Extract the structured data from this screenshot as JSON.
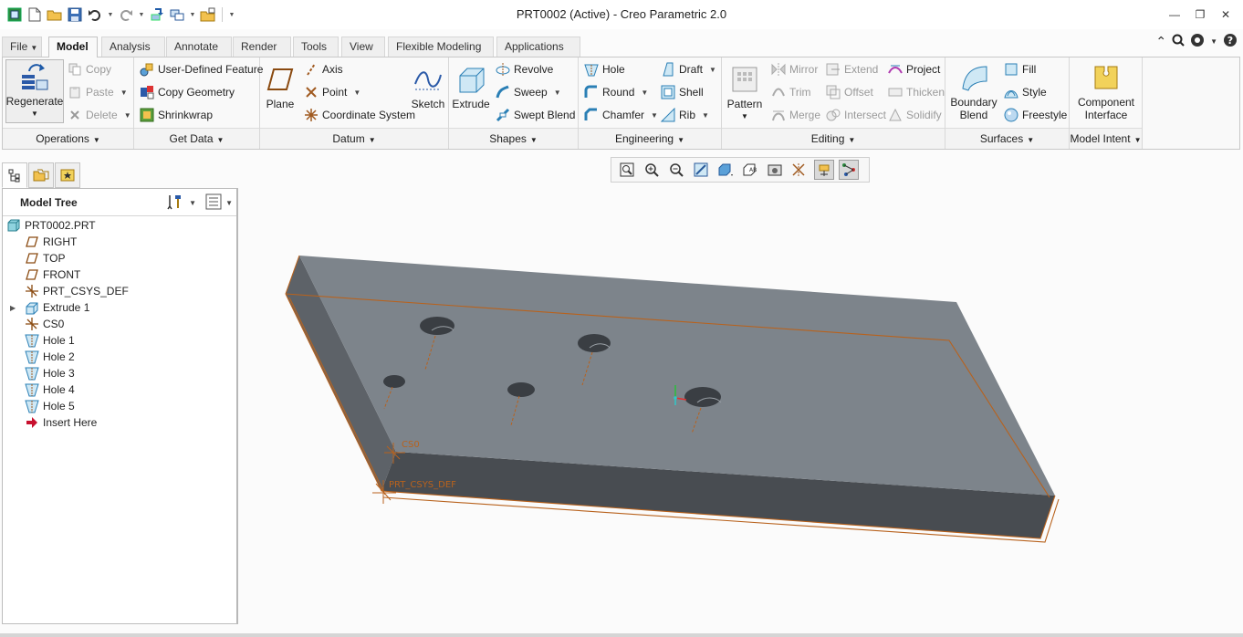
{
  "window": {
    "title": "PRT0002 (Active) - Creo Parametric 2.0",
    "minimize_glyph": "—",
    "restore_glyph": "❐",
    "close_glyph": "✕"
  },
  "tabs": [
    {
      "label": "File"
    },
    {
      "label": "Model"
    },
    {
      "label": "Analysis"
    },
    {
      "label": "Annotate"
    },
    {
      "label": "Render"
    },
    {
      "label": "Tools"
    },
    {
      "label": "View"
    },
    {
      "label": "Flexible Modeling"
    },
    {
      "label": "Applications"
    }
  ],
  "ribbon": {
    "operations": {
      "label": "Operations",
      "regenerate": "Regenerate",
      "copy": "Copy",
      "paste": "Paste",
      "delete": "Delete"
    },
    "get_data": {
      "label": "Get Data",
      "udf": "User-Defined Feature",
      "copy_geometry": "Copy Geometry",
      "shrinkwrap": "Shrinkwrap"
    },
    "datum": {
      "label": "Datum",
      "plane": "Plane",
      "axis": "Axis",
      "point": "Point",
      "csys": "Coordinate System",
      "sketch": "Sketch"
    },
    "shapes": {
      "label": "Shapes",
      "extrude": "Extrude",
      "revolve": "Revolve",
      "sweep": "Sweep",
      "swept_blend": "Swept Blend"
    },
    "engineering": {
      "label": "Engineering",
      "hole": "Hole",
      "round": "Round",
      "chamfer": "Chamfer",
      "draft": "Draft",
      "shell": "Shell",
      "rib": "Rib"
    },
    "editing": {
      "label": "Editing",
      "pattern": "Pattern",
      "mirror": "Mirror",
      "trim": "Trim",
      "merge": "Merge",
      "extend": "Extend",
      "offset": "Offset",
      "intersect": "Intersect",
      "project": "Project",
      "thicken": "Thicken",
      "solidify": "Solidify"
    },
    "surfaces": {
      "label": "Surfaces",
      "boundary_blend_1": "Boundary",
      "boundary_blend_2": "Blend",
      "fill": "Fill",
      "style": "Style",
      "freestyle": "Freestyle"
    },
    "model_intent": {
      "label": "Model Intent",
      "component_1": "Component",
      "component_2": "Interface"
    }
  },
  "model_tree": {
    "title": "Model Tree",
    "items": [
      {
        "label": "PRT0002.PRT",
        "icon": "part-icon"
      },
      {
        "label": "RIGHT",
        "icon": "datum-plane-icon"
      },
      {
        "label": "TOP",
        "icon": "datum-plane-icon"
      },
      {
        "label": "FRONT",
        "icon": "datum-plane-icon"
      },
      {
        "label": "PRT_CSYS_DEF",
        "icon": "csys-icon"
      },
      {
        "label": "Extrude 1",
        "icon": "extrude-icon"
      },
      {
        "label": "CS0",
        "icon": "csys-icon"
      },
      {
        "label": "Hole 1",
        "icon": "hole-icon"
      },
      {
        "label": "Hole 2",
        "icon": "hole-icon"
      },
      {
        "label": "Hole 3",
        "icon": "hole-icon"
      },
      {
        "label": "Hole 4",
        "icon": "hole-icon"
      },
      {
        "label": "Hole 5",
        "icon": "hole-icon"
      },
      {
        "label": "Insert Here",
        "icon": "insert-arrow-icon"
      }
    ]
  },
  "viewport": {
    "csys_label_1": "CS0",
    "csys_label_2": "PRT_CSYS_DEF",
    "colors": {
      "top_face": "#7d848b",
      "front_face": "#484c51",
      "side_face": "#5d6268",
      "edge_highlight": "#b8621d"
    }
  },
  "colors": {
    "accent": "#0070c0",
    "ribbon_bg": "#f9f9f9"
  }
}
